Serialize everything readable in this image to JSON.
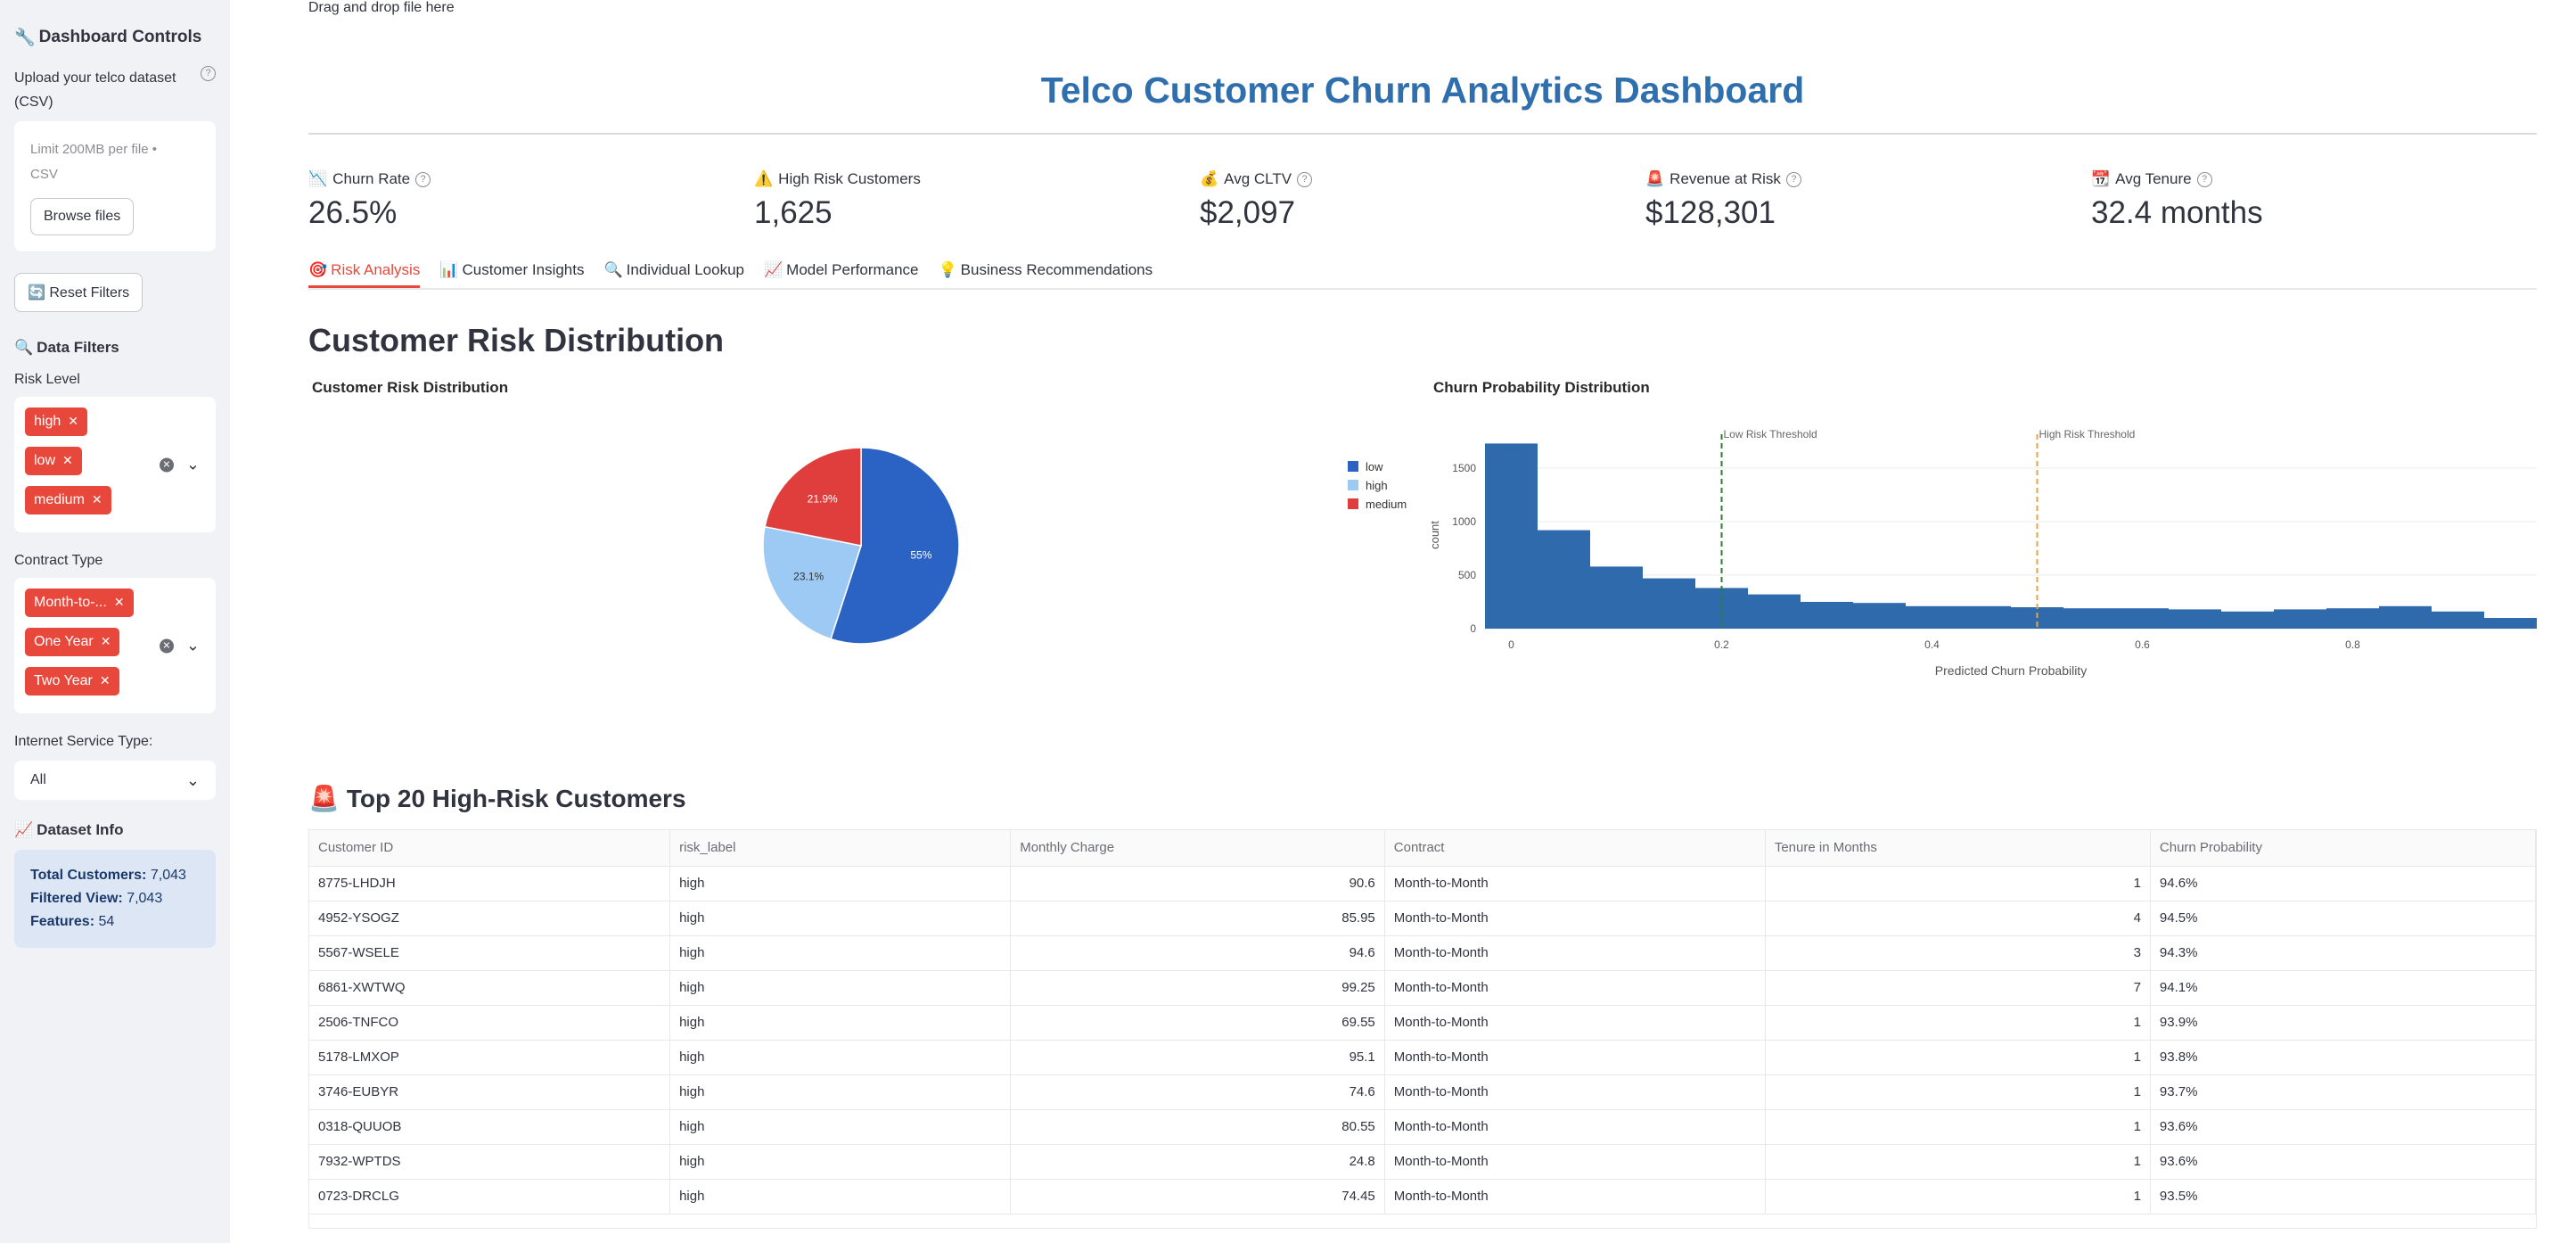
{
  "sidebar": {
    "title": "Dashboard Controls",
    "title_icon": "wrench-icon",
    "upload_label": "Upload your telco dataset (CSV)",
    "upload_main": "Drag and drop file here",
    "upload_limit": "Limit 200MB per file •",
    "upload_type": "CSV",
    "browse_label": "Browse files",
    "reset_label": "Reset Filters",
    "filters_title": "Data Filters",
    "risk_label": "Risk Level",
    "risk_chips": [
      "high",
      "low",
      "medium"
    ],
    "contract_label": "Contract Type",
    "contract_chips": [
      "Month-to-...",
      "One Year",
      "Two Year"
    ],
    "internet_label": "Internet Service Type:",
    "internet_value": "All",
    "dataset_title": "Dataset Info",
    "info": {
      "total_label": "Total Customers:",
      "total_value": "7,043",
      "filtered_label": "Filtered View:",
      "filtered_value": "7,043",
      "features_label": "Features:",
      "features_value": "54"
    }
  },
  "header": {
    "title": "Telco Customer Churn Analytics Dashboard"
  },
  "metrics": [
    {
      "label": "Churn Rate",
      "value": "26.5%"
    },
    {
      "label": "High Risk Customers",
      "value": "1,625"
    },
    {
      "label": "Avg CLTV",
      "value": "$2,097"
    },
    {
      "label": "Revenue at Risk",
      "value": "$128,301"
    },
    {
      "label": "Avg Tenure",
      "value": "32.4 months"
    }
  ],
  "tabs": [
    "Risk Analysis",
    "Customer Insights",
    "Individual Lookup",
    "Model Performance",
    "Business Recommendations"
  ],
  "section_title": "Customer Risk Distribution",
  "chart_data": [
    {
      "type": "pie",
      "title": "Customer Risk Distribution",
      "categories": [
        "low",
        "high",
        "medium"
      ],
      "values": [
        55,
        23.1,
        21.9
      ],
      "slice_labels": [
        "55%",
        "23.1%",
        "21.9%"
      ],
      "colors": [
        "#2a63c4",
        "#9ccaf4",
        "#e03d3d"
      ],
      "legend_position": "right"
    },
    {
      "type": "bar",
      "title": "Churn Probability Distribution",
      "xlabel": "Predicted Churn Probability",
      "ylabel": "count",
      "x_bin_width": 0.05,
      "x_range": [
        -0.025,
        0.975
      ],
      "y_range": [
        0,
        1750
      ],
      "x_ticks": [
        "0",
        "0.2",
        "0.4",
        "0.6",
        "0.8"
      ],
      "y_ticks": [
        "0",
        "500",
        "1000",
        "1500"
      ],
      "values": [
        1730,
        920,
        580,
        470,
        380,
        320,
        250,
        240,
        210,
        210,
        200,
        190,
        190,
        180,
        160,
        180,
        190,
        210,
        160,
        100,
        20
      ],
      "color": "#2f6aad",
      "annotations": [
        {
          "x": 0.2,
          "label": "Low Risk Threshold",
          "color": "#2e7d32"
        },
        {
          "x": 0.5,
          "label": "High Risk Threshold",
          "color": "#f0a040"
        }
      ],
      "grid": true
    }
  ],
  "table": {
    "title": "Top 20 High-Risk Customers",
    "columns": [
      "Customer ID",
      "risk_label",
      "Monthly Charge",
      "Contract",
      "Tenure in Months",
      "Churn Probability"
    ],
    "rows": [
      [
        "8775-LHDJH",
        "high",
        "90.6",
        "Month-to-Month",
        "1",
        "94.6%"
      ],
      [
        "4952-YSOGZ",
        "high",
        "85.95",
        "Month-to-Month",
        "4",
        "94.5%"
      ],
      [
        "5567-WSELE",
        "high",
        "94.6",
        "Month-to-Month",
        "3",
        "94.3%"
      ],
      [
        "6861-XWTWQ",
        "high",
        "99.25",
        "Month-to-Month",
        "7",
        "94.1%"
      ],
      [
        "2506-TNFCO",
        "high",
        "69.55",
        "Month-to-Month",
        "1",
        "93.9%"
      ],
      [
        "5178-LMXOP",
        "high",
        "95.1",
        "Month-to-Month",
        "1",
        "93.8%"
      ],
      [
        "3746-EUBYR",
        "high",
        "74.6",
        "Month-to-Month",
        "1",
        "93.7%"
      ],
      [
        "0318-QUUOB",
        "high",
        "80.55",
        "Month-to-Month",
        "1",
        "93.6%"
      ],
      [
        "7932-WPTDS",
        "high",
        "24.8",
        "Month-to-Month",
        "1",
        "93.6%"
      ],
      [
        "0723-DRCLG",
        "high",
        "74.45",
        "Month-to-Month",
        "1",
        "93.5%"
      ]
    ]
  }
}
